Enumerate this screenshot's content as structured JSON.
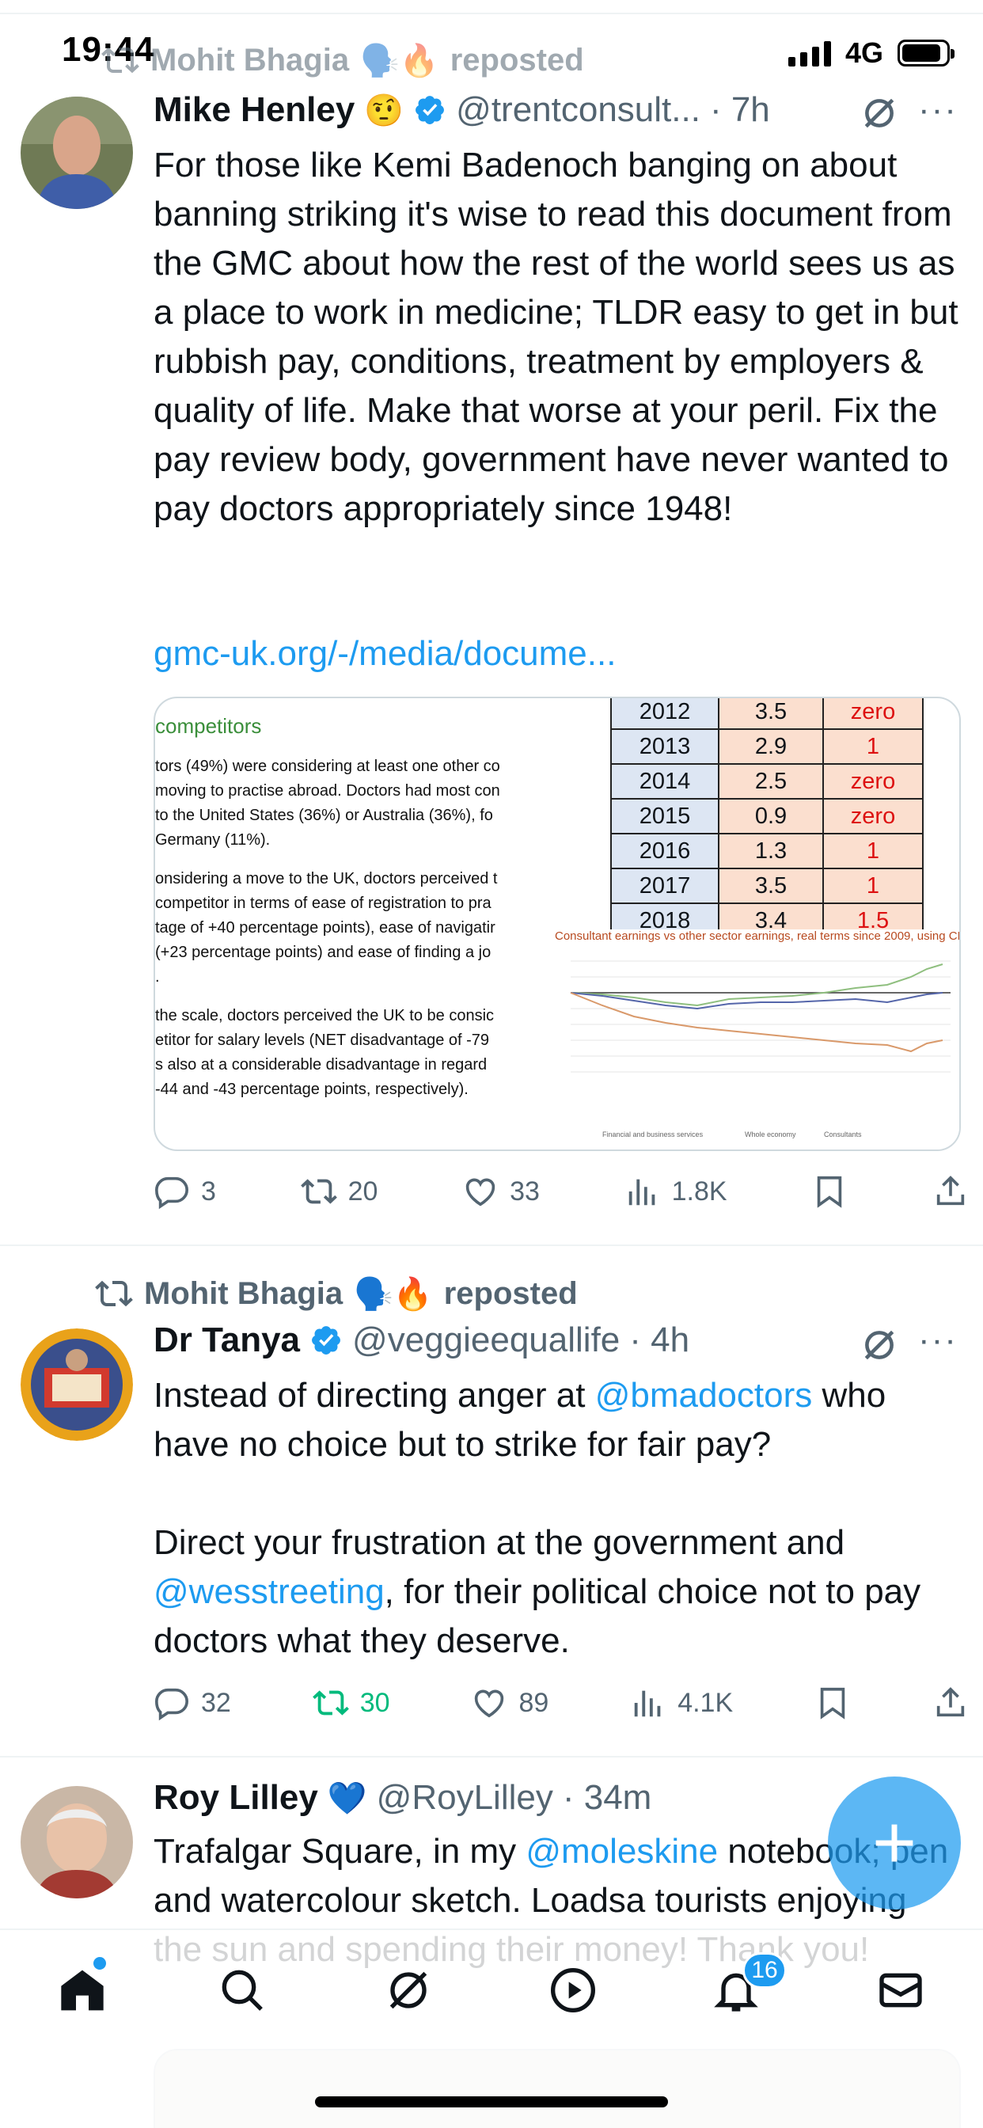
{
  "status_bar": {
    "time": "19:44",
    "network": "4G"
  },
  "tweets": [
    {
      "reposted_by": "Mohit Bhagia",
      "reposted_label": "reposted",
      "name": "Mike Henley",
      "name_emoji": "🤨",
      "handle": "@trentconsult...",
      "time": "· 7h",
      "text": "For those like Kemi Badenoch banging on about banning striking it's wise to read this document from the GMC about how the rest of the world sees us as a place to work in medicine; TLDR easy to get in but rubbish pay, conditions, treatment by employers & quality of life. Make that worse at your peril. Fix the pay review body, government have never wanted to pay doctors appropriately since 1948!",
      "link": "gmc-uk.org/-/media/docume...",
      "media": {
        "doc_title": "competitors",
        "doc_lines": [
          "tors (49%) were considering at least one other co",
          "moving to practise abroad. Doctors had most con",
          "to the United States (36%) or Australia (36%), fo",
          "Germany (11%).",
          "onsidering a move to the UK, doctors perceived t",
          "competitor in terms of ease of registration to pra",
          "tage of +40 percentage points), ease of navigatir",
          "(+23 percentage points) and ease of finding a jo",
          ".",
          "the scale, doctors perceived the UK to be consic",
          "etitor for salary levels (NET disadvantage of -79",
          "s also at a considerable disadvantage in regard",
          "-44 and -43 percentage points, respectively)."
        ],
        "table": [
          [
            "2012",
            "3.5",
            "zero"
          ],
          [
            "2013",
            "2.9",
            "1"
          ],
          [
            "2014",
            "2.5",
            "zero"
          ],
          [
            "2015",
            "0.9",
            "zero"
          ],
          [
            "2016",
            "1.3",
            "1"
          ],
          [
            "2017",
            "3.5",
            "1"
          ],
          [
            "2018",
            "3.4",
            "1.5"
          ]
        ],
        "chart_title": "Consultant earnings vs other sector earnings, real terms since 2009, using CPI inflation",
        "legend": [
          "Financial and business services",
          "Whole economy",
          "Consultants"
        ]
      },
      "actions": {
        "replies": "3",
        "reposts": "20",
        "likes": "33",
        "views": "1.8K"
      }
    },
    {
      "reposted_by": "Mohit Bhagia",
      "reposted_label": "reposted",
      "name": "Dr Tanya",
      "handle": "@veggieequallife",
      "time": "· 4h",
      "text_parts": [
        "Instead of directing anger at ",
        "@bmadoctors",
        " who have no choice but to strike for fair pay?\n\nDirect your frustration at the government and ",
        "@wesstreeting",
        ", for their political choice not to pay doctors what they deserve."
      ],
      "actions": {
        "replies": "32",
        "reposts": "30",
        "likes": "89",
        "views": "4.1K"
      }
    },
    {
      "name": "Roy Lilley",
      "name_emoji": "💙",
      "handle": "@RoyLilley",
      "time": "· 34m",
      "text_parts": [
        "Trafalgar Square, in my ",
        "@moleskine",
        " notebook; pen and watercolour sketch. Loadsa tourists enjoying the sun and spending their money! Thank you!"
      ]
    }
  ],
  "bottom_nav": {
    "notification_count": "16"
  },
  "colors": {
    "accent": "#1d9bf0",
    "retweet_green": "#00ba7c",
    "secondary_text": "#536471"
  }
}
